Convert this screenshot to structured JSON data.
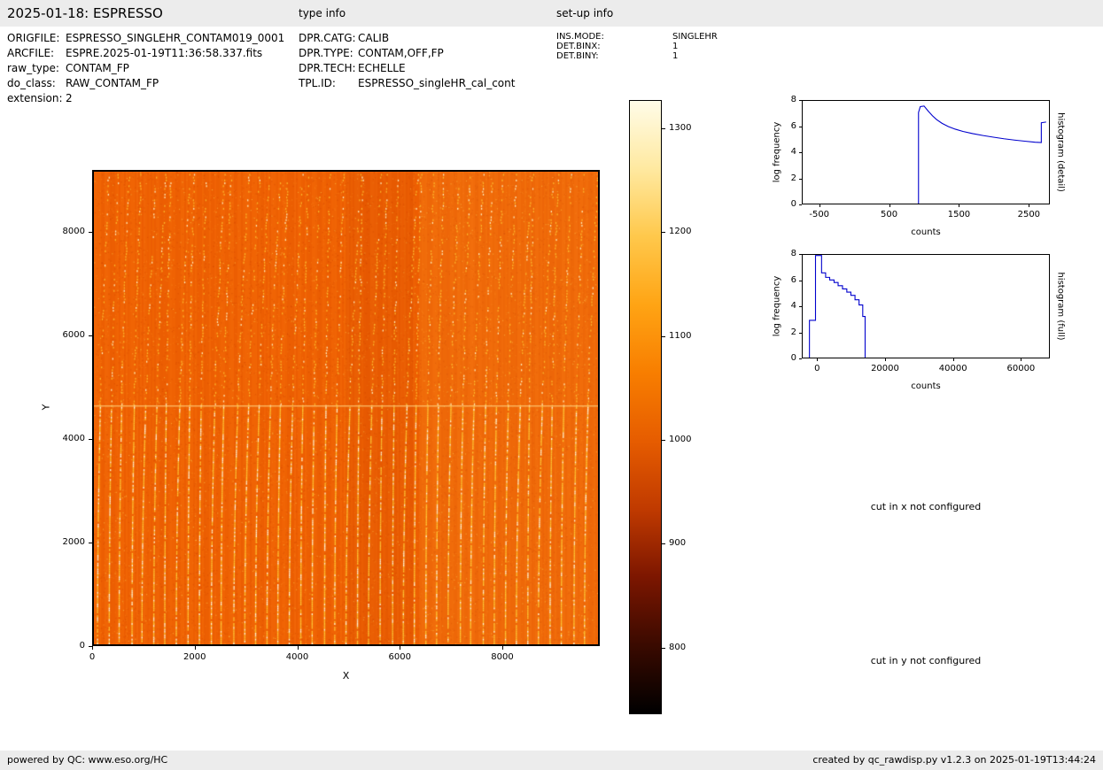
{
  "header": {
    "title": "2025-01-18: ESPRESSO",
    "type_info_label": "type info",
    "setup_info_label": "set-up info"
  },
  "metadata": {
    "file_info": [
      {
        "label": "ORIGFILE:",
        "value": "ESPRESSO_SINGLEHR_CONTAM019_0001"
      },
      {
        "label": "ARCFILE:",
        "value": "ESPRE.2025-01-19T11:36:58.337.fits"
      },
      {
        "label": "raw_type:",
        "value": "CONTAM_FP"
      },
      {
        "label": "do_class:",
        "value": "RAW_CONTAM_FP"
      },
      {
        "label": "extension:",
        "value": "2"
      }
    ],
    "type_info": [
      {
        "label": "DPR.CATG:",
        "value": "CALIB"
      },
      {
        "label": "DPR.TYPE:",
        "value": "CONTAM,OFF,FP"
      },
      {
        "label": "DPR.TECH:",
        "value": "ECHELLE"
      },
      {
        "label": "TPL.ID:",
        "value": "ESPRESSO_singleHR_cal_cont"
      }
    ],
    "setup_info": [
      {
        "label": "INS.MODE:",
        "value": "SINGLEHR"
      },
      {
        "label": "DET.BINX:",
        "value": "1"
      },
      {
        "label": "DET.BINY:",
        "value": "1"
      }
    ]
  },
  "messages": {
    "cut_x": "cut in x not configured",
    "cut_y": "cut in y not configured"
  },
  "footer": {
    "left": "powered by QC: www.eso.org/HC",
    "right": "created by qc_rawdisp.py v1.2.3 on 2025-01-19T13:44:24"
  },
  "chart_data": [
    {
      "id": "raw_frame_image",
      "type": "heatmap",
      "xlabel": "X",
      "ylabel": "Y",
      "xlim": [
        0,
        9900
      ],
      "ylim": [
        0,
        9200
      ],
      "xticks": [
        0,
        2000,
        4000,
        6000,
        8000
      ],
      "yticks": [
        0,
        2000,
        4000,
        6000,
        8000
      ],
      "colorbar": {
        "vmin": 736,
        "vmax": 1327,
        "ticks": [
          800,
          900,
          1000,
          1100,
          1200,
          1300
        ],
        "colormap": "black-red-orange-yellow-white heat scale",
        "stops": [
          "#000000",
          "#3a0a00",
          "#7c1600",
          "#c03a00",
          "#e65c00",
          "#f87e00",
          "#ffa414",
          "#ffc84b",
          "#ffe9a0",
          "#fffce8"
        ]
      }
    },
    {
      "id": "histogram_detail",
      "type": "line",
      "xlabel": "counts",
      "ylabel": "log frequency",
      "side_label": "histogram (detail)",
      "xlim": [
        -750,
        2800
      ],
      "ylim": [
        0,
        8
      ],
      "xticks": [
        -500,
        500,
        1500,
        2500
      ],
      "yticks": [
        0,
        2,
        4,
        6,
        8
      ],
      "line_color": "#0000cd",
      "points": [
        [
          920,
          0
        ],
        [
          920,
          7.1
        ],
        [
          945,
          7.55
        ],
        [
          1000,
          7.6
        ],
        [
          1060,
          7.2
        ],
        [
          1120,
          6.85
        ],
        [
          1180,
          6.55
        ],
        [
          1260,
          6.25
        ],
        [
          1350,
          6.0
        ],
        [
          1450,
          5.8
        ],
        [
          1560,
          5.62
        ],
        [
          1700,
          5.45
        ],
        [
          1850,
          5.3
        ],
        [
          2000,
          5.17
        ],
        [
          2150,
          5.05
        ],
        [
          2300,
          4.95
        ],
        [
          2450,
          4.86
        ],
        [
          2600,
          4.78
        ],
        [
          2690,
          4.75
        ],
        [
          2690,
          6.3
        ],
        [
          2760,
          6.35
        ]
      ]
    },
    {
      "id": "histogram_full",
      "type": "line",
      "xlabel": "counts",
      "ylabel": "log frequency",
      "side_label": "histogram (full)",
      "xlim": [
        -4500,
        68500
      ],
      "ylim": [
        0,
        8
      ],
      "xticks": [
        0,
        20000,
        40000,
        60000
      ],
      "yticks": [
        0,
        2,
        4,
        6,
        8
      ],
      "line_color": "#0000cd",
      "points": [
        [
          -2500,
          0
        ],
        [
          -2500,
          2.9
        ],
        [
          -700,
          2.9
        ],
        [
          -700,
          7.95
        ],
        [
          1100,
          7.95
        ],
        [
          1100,
          6.6
        ],
        [
          2300,
          6.6
        ],
        [
          2300,
          6.25
        ],
        [
          3500,
          6.25
        ],
        [
          3500,
          6.05
        ],
        [
          4800,
          6.05
        ],
        [
          4800,
          5.85
        ],
        [
          6000,
          5.85
        ],
        [
          6000,
          5.6
        ],
        [
          7300,
          5.6
        ],
        [
          7300,
          5.35
        ],
        [
          8600,
          5.35
        ],
        [
          8600,
          5.1
        ],
        [
          9800,
          5.1
        ],
        [
          9800,
          4.85
        ],
        [
          11000,
          4.85
        ],
        [
          11000,
          4.5
        ],
        [
          12200,
          4.5
        ],
        [
          12200,
          4.1
        ],
        [
          13300,
          4.1
        ],
        [
          13300,
          3.2
        ],
        [
          14000,
          3.2
        ],
        [
          14000,
          0
        ]
      ]
    }
  ]
}
